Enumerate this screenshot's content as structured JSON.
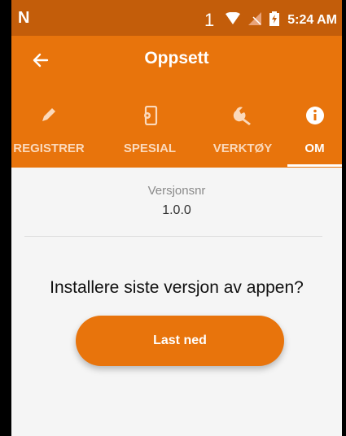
{
  "status_bar": {
    "left_icon": "N",
    "sim_number": "1",
    "time": "5:24 AM",
    "icons": [
      "wifi-icon",
      "no-signal-icon",
      "battery-charging-icon"
    ]
  },
  "app_bar": {
    "title": "Oppsett",
    "back_icon": "arrow-left-icon"
  },
  "tabs": [
    {
      "label": "REGISTRER",
      "icon": "pencil-icon",
      "active": false
    },
    {
      "label": "SPESIAL",
      "icon": "phone-settings-icon",
      "active": false
    },
    {
      "label": "VERKTØY",
      "icon": "wrench-icon",
      "active": false
    },
    {
      "label": "OM",
      "icon": "info-icon",
      "active": true
    }
  ],
  "about": {
    "version_label": "Versjonsnr",
    "version_value": "1.0.0",
    "question": "Installere siste versjon av appen?",
    "download_label": "Last ned"
  },
  "colors": {
    "status_bar": "#c35d0a",
    "primary": "#e8740c",
    "background": "#f5f5f5"
  }
}
